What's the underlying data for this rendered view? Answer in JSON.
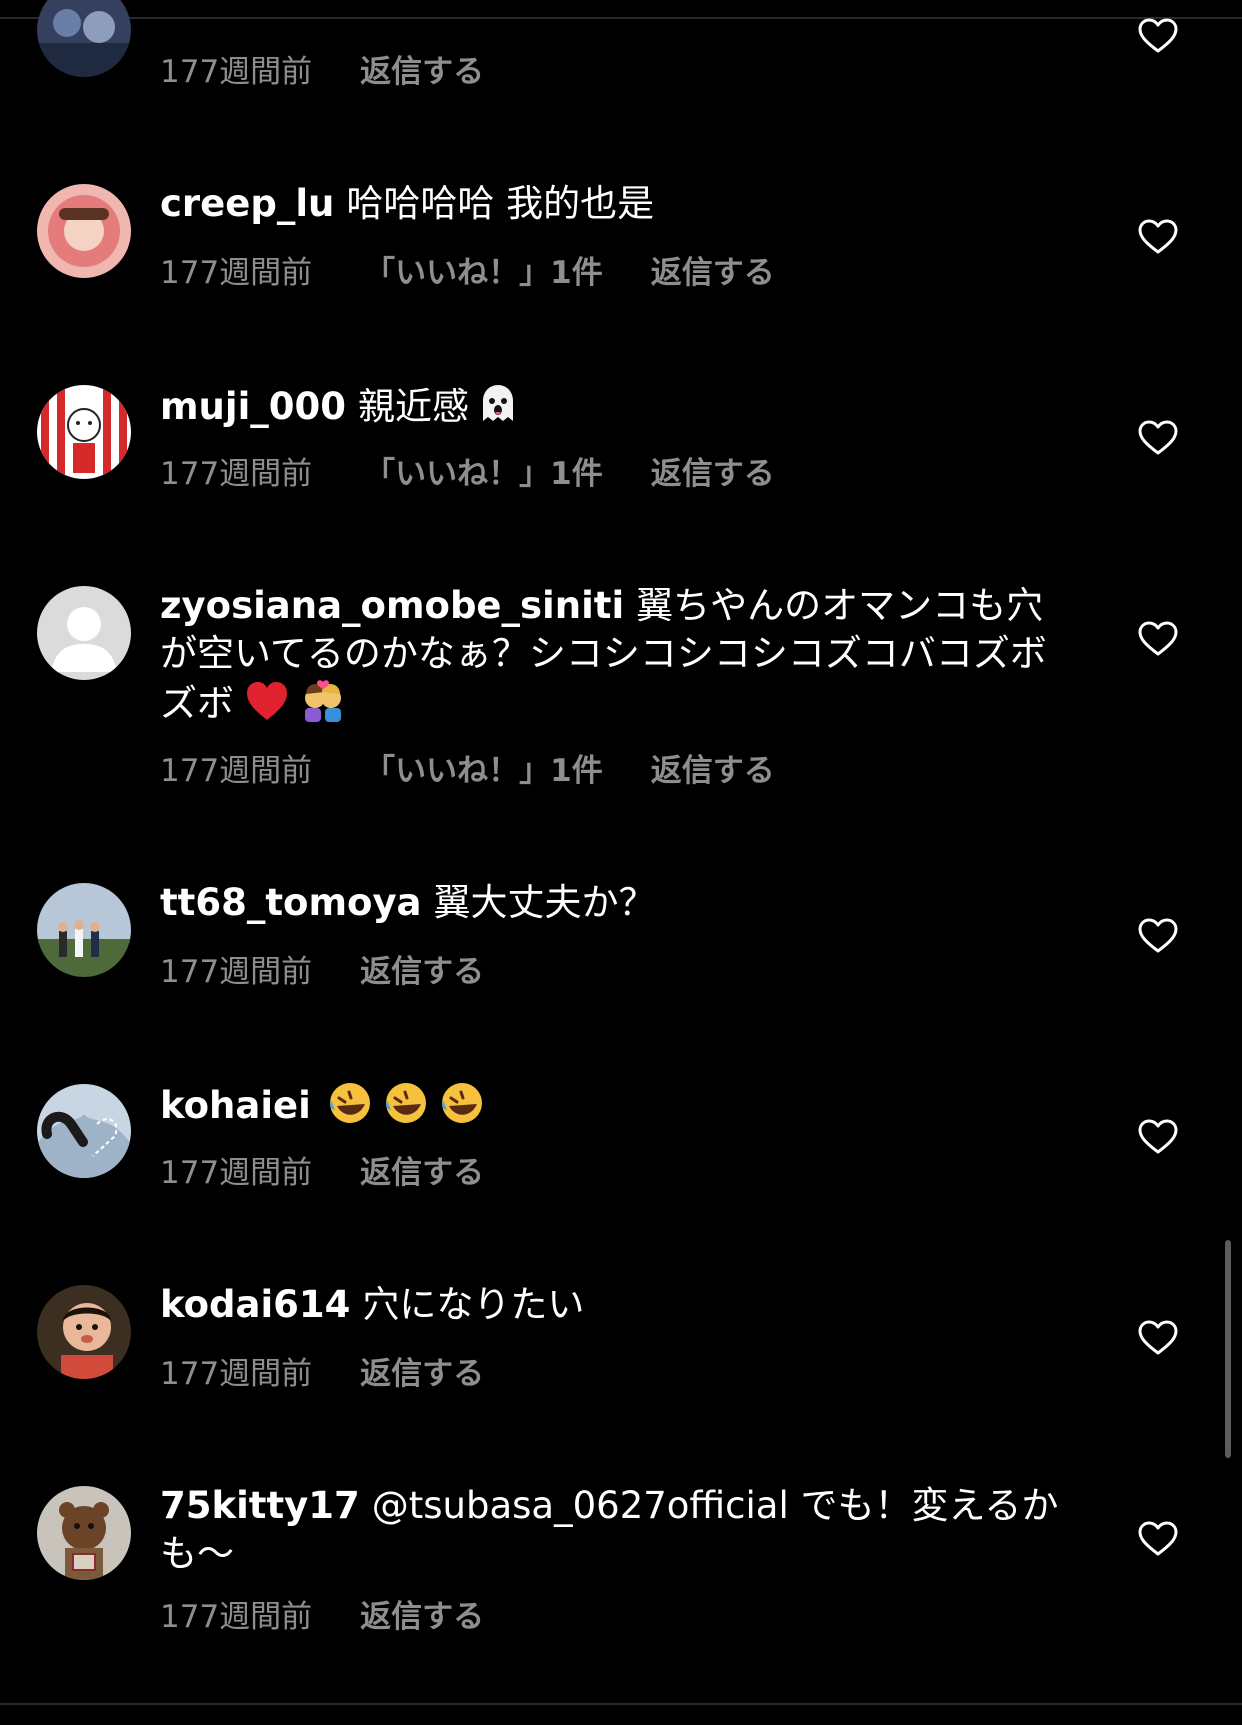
{
  "comments": [
    {
      "username": "",
      "text": "",
      "time": "177週間前",
      "likes": "",
      "reply": "返信する",
      "avatar_colors": [
        "#3a4a6a",
        "#6a7fa8"
      ]
    },
    {
      "username": "creep_lu",
      "text": "哈哈哈哈 我的也是",
      "time": "177週間前",
      "likes": "「いいね！」1件",
      "reply": "返信する",
      "avatar_colors": [
        "#e7a0a0",
        "#f4d3c4"
      ]
    },
    {
      "username": "muji_000",
      "text": "親近感",
      "emojis": [
        "ghost-emoji"
      ],
      "time": "177週間前",
      "likes": "「いいね！」1件",
      "reply": "返信する",
      "avatar_colors": [
        "#d42a2a",
        "#ffffff"
      ]
    },
    {
      "username": "zyosiana_omobe_siniti",
      "text": "翼ちやんのオマンコも穴が空いてるのかなぁ？シコシコシコシコズコバコズボズボ",
      "emojis": [
        "red-heart-emoji",
        "kiss-couple-emoji"
      ],
      "time": "177週間前",
      "likes": "「いいね！」1件",
      "reply": "返信する",
      "avatar_colors": [
        "#dcdcdc",
        "#ffffff"
      ]
    },
    {
      "username": "tt68_tomoya",
      "text": "翼大丈夫か？",
      "time": "177週間前",
      "likes": "",
      "reply": "返信する",
      "avatar_colors": [
        "#9fb3c8",
        "#4f6a3a"
      ]
    },
    {
      "username": "kohaiei",
      "text": "",
      "emojis": [
        "rolling-laughing-emoji",
        "rolling-laughing-emoji",
        "rolling-laughing-emoji"
      ],
      "time": "177週間前",
      "likes": "",
      "reply": "返信する",
      "avatar_colors": [
        "#b9c9d8",
        "#2a2a2a"
      ]
    },
    {
      "username": "kodai614",
      "text": "穴になりたい",
      "time": "177週間前",
      "likes": "",
      "reply": "返信する",
      "avatar_colors": [
        "#3d2e22",
        "#e9b89a"
      ]
    },
    {
      "username": "75kitty17",
      "mention": "@tsubasa_0627official",
      "text": " でも！変えるかも〜",
      "time": "177週間前",
      "likes": "",
      "reply": "返信する",
      "avatar_colors": [
        "#c8c4bc",
        "#6b4428"
      ]
    }
  ],
  "colors": {
    "background": "#000000",
    "text": "#ffffff",
    "meta": "#8e8e8e"
  },
  "icons": {
    "heart": "heart-outline-icon"
  }
}
